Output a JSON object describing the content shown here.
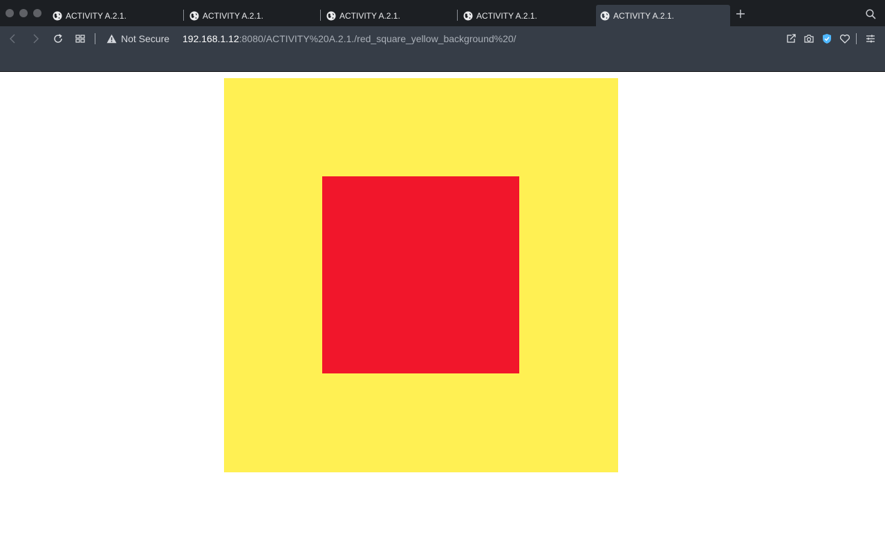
{
  "browser": {
    "tabs": [
      {
        "title": "ACTIVITY A.2.1.",
        "active": false
      },
      {
        "title": "ACTIVITY A.2.1.",
        "active": false
      },
      {
        "title": "ACTIVITY A.2.1.",
        "active": false
      },
      {
        "title": "ACTIVITY A.2.1.",
        "active": false
      },
      {
        "title": "ACTIVITY A.2.1.",
        "active": true
      }
    ],
    "security_label": "Not Secure",
    "url_host": "192.168.1.12",
    "url_rest": ":8080/ACTIVITY%20A.2.1./red_square_yellow_background%20/",
    "icons": {
      "back": "chevron-left-icon",
      "forward": "chevron-right-icon",
      "reload": "reload-icon",
      "tabs_grid": "grid-icon",
      "warning": "warning-icon",
      "share": "share-icon",
      "camera": "camera-icon",
      "shield": "shield-check-icon",
      "favorite": "heart-icon",
      "settings": "sliders-icon",
      "new_tab": "plus-icon",
      "search": "search-icon"
    }
  },
  "page": {
    "background_color": "#fff053",
    "square_color": "#f1162b"
  }
}
